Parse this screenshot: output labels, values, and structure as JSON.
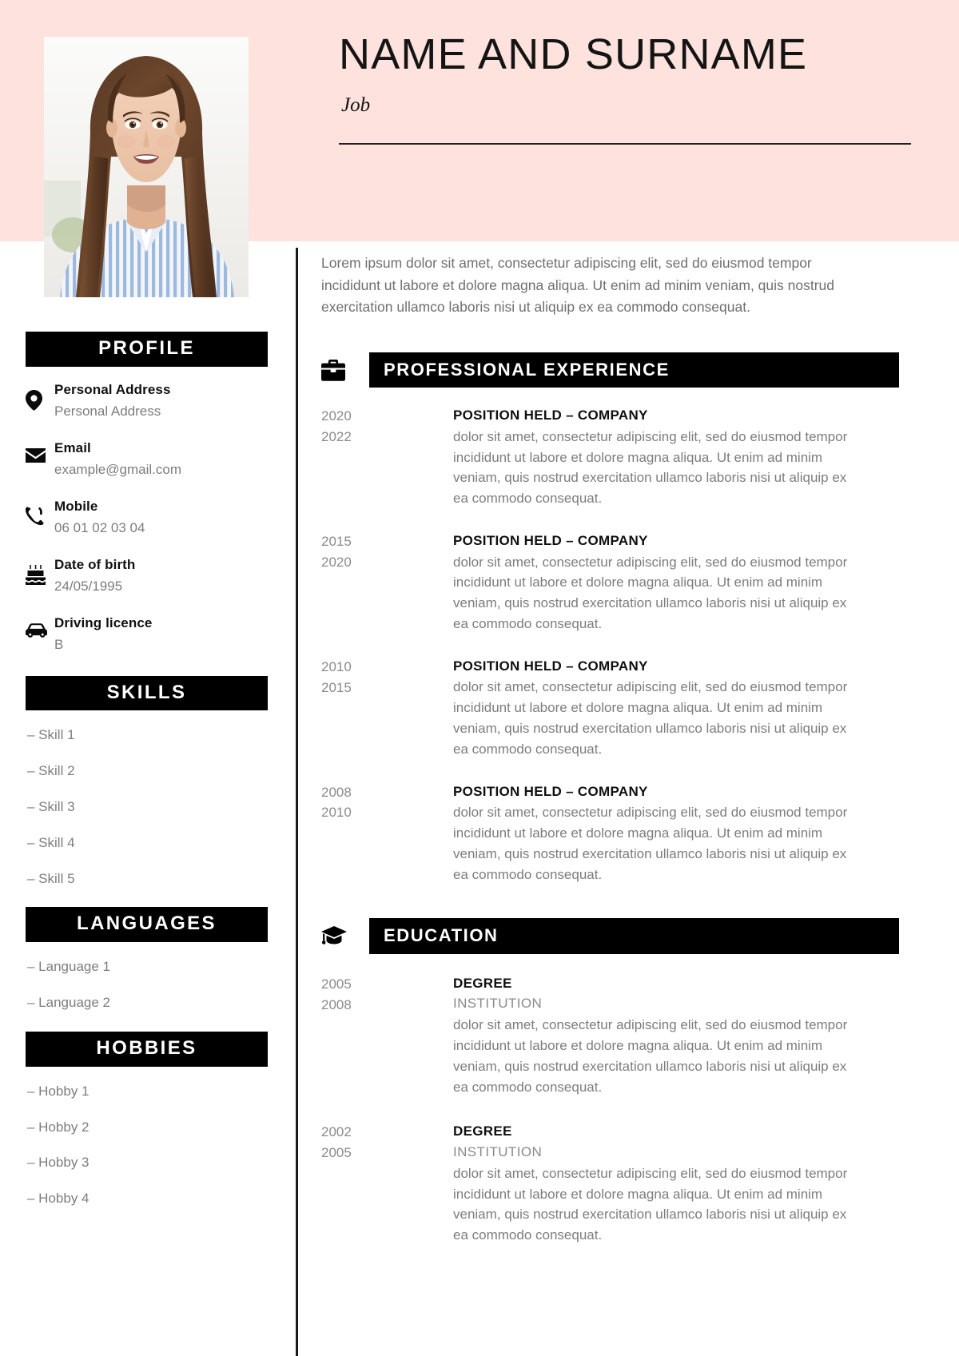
{
  "header": {
    "name": "NAME AND SURNAME",
    "job": "Job",
    "band_color": "#fde2dd"
  },
  "photo": {
    "alt": "portrait-photo"
  },
  "sidebar": {
    "profile": {
      "heading": "PROFILE",
      "items": [
        {
          "icon": "location-pin-icon",
          "label": "Personal Address",
          "value": "Personal Address"
        },
        {
          "icon": "envelope-icon",
          "label": "Email",
          "value": "example@gmail.com"
        },
        {
          "icon": "phone-icon",
          "label": "Mobile",
          "value": "06 01 02 03 04"
        },
        {
          "icon": "birthday-cake-icon",
          "label": "Date of birth",
          "value": "24/05/1995"
        },
        {
          "icon": "car-icon",
          "label": "Driving licence",
          "value": "B"
        }
      ]
    },
    "skills": {
      "heading": "SKILLS",
      "items": [
        "– Skill 1",
        "– Skill 2",
        "– Skill 3",
        "– Skill 4",
        "– Skill 5"
      ]
    },
    "languages": {
      "heading": "LANGUAGES",
      "items": [
        "– Language 1",
        "– Language 2"
      ]
    },
    "hobbies": {
      "heading": "HOBBIES",
      "items": [
        "– Hobby 1",
        "– Hobby 2",
        "– Hobby 3",
        "– Hobby 4"
      ]
    }
  },
  "main": {
    "intro": "Lorem ipsum dolor sit amet, consectetur adipiscing elit, sed do eiusmod tempor incididunt ut labore et dolore magna aliqua. Ut enim ad minim veniam, quis nostrud exercitation ullamco laboris nisi ut aliquip ex ea commodo consequat.",
    "experience": {
      "heading": "PROFESSIONAL EXPERIENCE",
      "icon": "briefcase-icon",
      "entries": [
        {
          "year_start": "2020",
          "year_end": "2022",
          "title": "POSITION HELD – COMPANY",
          "description": "dolor sit amet, consectetur adipiscing elit, sed do eiusmod tempor incididunt ut labore et dolore magna aliqua. Ut enim ad minim veniam, quis nostrud exercitation ullamco laboris nisi ut aliquip ex ea commodo consequat."
        },
        {
          "year_start": "2015",
          "year_end": "2020",
          "title": "POSITION HELD – COMPANY",
          "description": "dolor sit amet, consectetur adipiscing elit, sed do eiusmod tempor incididunt ut labore et dolore magna aliqua. Ut enim ad minim veniam, quis nostrud exercitation ullamco laboris nisi ut aliquip ex ea commodo consequat."
        },
        {
          "year_start": "2010",
          "year_end": "2015",
          "title": "POSITION HELD – COMPANY",
          "description": "dolor sit amet, consectetur adipiscing elit, sed do eiusmod tempor incididunt ut labore et dolore magna aliqua. Ut enim ad minim veniam, quis nostrud exercitation ullamco laboris nisi ut aliquip ex ea commodo consequat."
        },
        {
          "year_start": "2008",
          "year_end": "2010",
          "title": "POSITION HELD – COMPANY",
          "description": "dolor sit amet, consectetur adipiscing elit, sed do eiusmod tempor incididunt ut labore et dolore magna aliqua. Ut enim ad minim veniam, quis nostrud exercitation ullamco laboris nisi ut aliquip ex ea commodo consequat."
        }
      ]
    },
    "education": {
      "heading": "EDUCATION",
      "icon": "graduation-cap-icon",
      "entries": [
        {
          "year_start": "2005",
          "year_end": "2008",
          "title": "DEGREE",
          "institution": "INSTITUTION",
          "description": "dolor sit amet, consectetur adipiscing elit, sed do eiusmod tempor incididunt ut labore et dolore magna aliqua. Ut enim ad minim veniam, quis nostrud exercitation ullamco laboris nisi ut aliquip ex ea commodo consequat."
        },
        {
          "year_start": "2002",
          "year_end": "2005",
          "title": "DEGREE",
          "institution": "INSTITUTION",
          "description": "dolor sit amet, consectetur adipiscing elit, sed do eiusmod tempor incididunt ut labore et dolore magna aliqua. Ut enim ad minim veniam, quis nostrud exercitation ullamco laboris nisi ut aliquip ex ea commodo consequat."
        }
      ]
    }
  }
}
